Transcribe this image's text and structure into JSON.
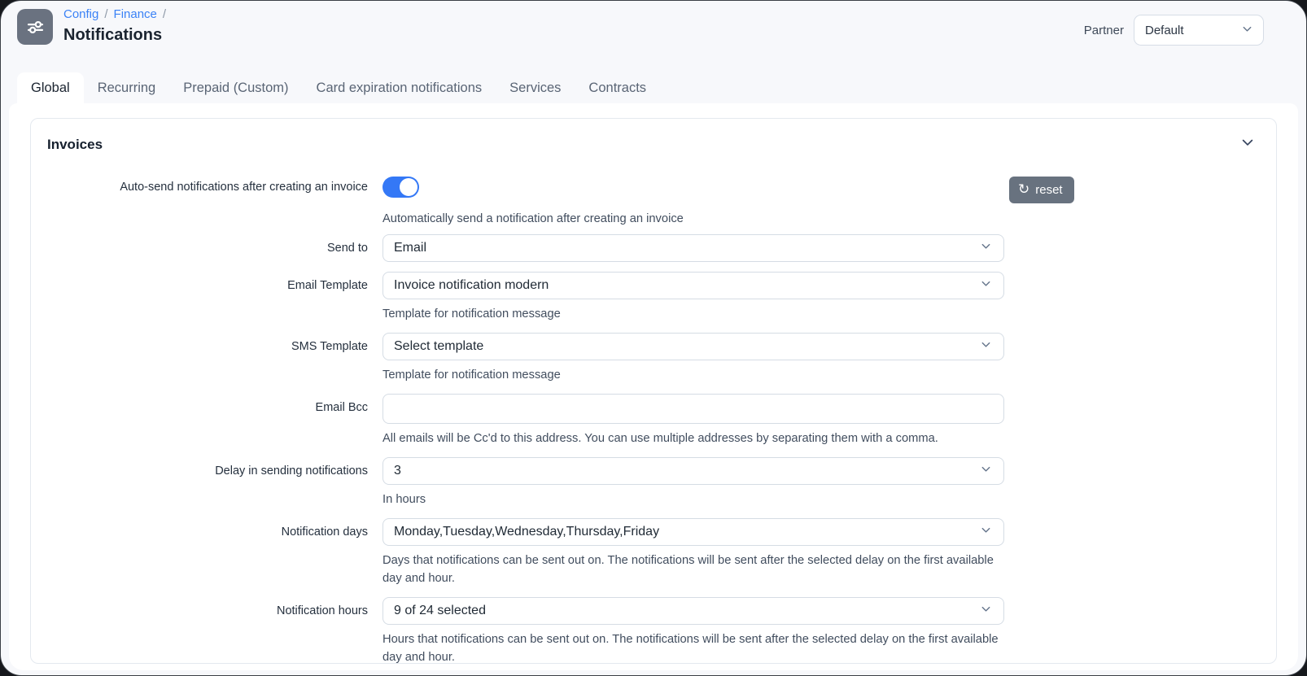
{
  "header": {
    "breadcrumb": {
      "config": "Config",
      "finance": "Finance",
      "separator": "/"
    },
    "title": "Notifications",
    "partner_label": "Partner",
    "partner_value": "Default",
    "app_icon": "sliders-icon"
  },
  "tabs": [
    {
      "label": "Global",
      "active": true
    },
    {
      "label": "Recurring",
      "active": false
    },
    {
      "label": "Prepaid (Custom)",
      "active": false
    },
    {
      "label": "Card expiration notifications",
      "active": false
    },
    {
      "label": "Services",
      "active": false
    },
    {
      "label": "Contracts",
      "active": false
    }
  ],
  "section": {
    "title": "Invoices",
    "collapse_icon": "chevron-down-icon",
    "reset_button": {
      "label": "reset",
      "icon": "refresh-icon"
    }
  },
  "fields": [
    {
      "type": "toggle",
      "label": "Auto-send notifications after creating an invoice",
      "state": "on",
      "help": "Automatically send a notification after creating an invoice"
    },
    {
      "type": "select",
      "label": "Send to",
      "value": "Email"
    },
    {
      "type": "select",
      "label": "Email Template",
      "value": "Invoice notification modern",
      "help": "Template for notification message"
    },
    {
      "type": "select",
      "label": "SMS Template",
      "value": "Select template",
      "help": "Template for notification message"
    },
    {
      "type": "input",
      "label": "Email Bcc",
      "value": "",
      "help": "All emails will be Cc'd to this address. You can use multiple addresses by separating them with a comma."
    },
    {
      "type": "select",
      "label": "Delay in sending notifications",
      "value": "3",
      "help": "In hours"
    },
    {
      "type": "select",
      "label": "Notification days",
      "value": "Monday,Tuesday,Wednesday,Thursday,Friday",
      "help": "Days that notifications can be sent out on. The notifications will be sent after the selected delay on the first available day and hour."
    },
    {
      "type": "select",
      "label": "Notification hours",
      "value": "9 of 24 selected",
      "help": "Hours that notifications can be sent out on. The notifications will be sent after the selected delay on the first available day and hour."
    }
  ],
  "colors": {
    "link_blue": "#3b82f6",
    "toggle_on": "#3478f6",
    "reset_button_bg": "#68727f",
    "app_icon_bg": "#6a7280",
    "border": "#d5dce4",
    "active_tab_bg": "#ffffff"
  }
}
